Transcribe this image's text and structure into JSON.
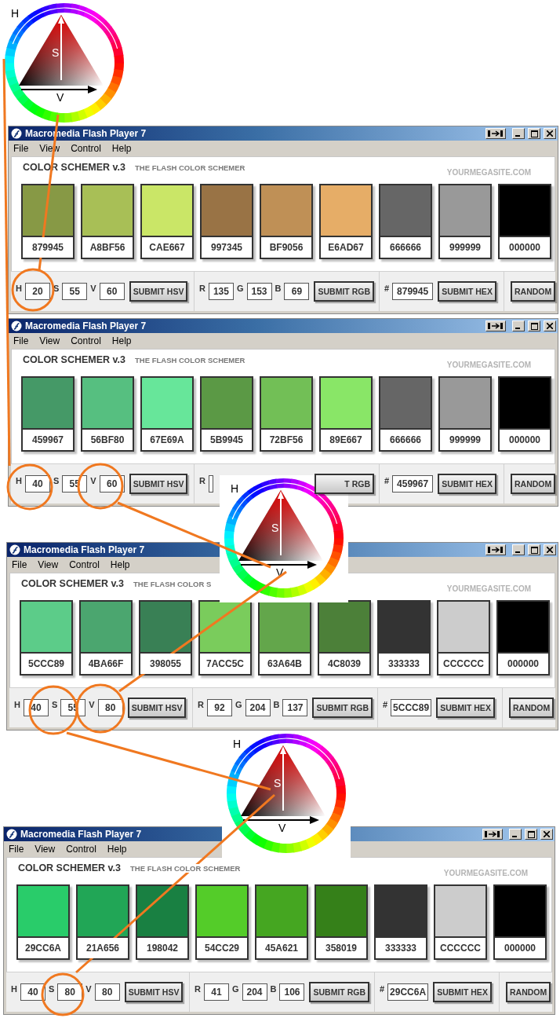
{
  "hsv_diagrams": [
    {
      "h": "H",
      "s": "S",
      "v": "V",
      "framed": false
    },
    {
      "h": "H",
      "s": "S",
      "v": "V",
      "framed": true
    },
    {
      "h": "H",
      "s": "S",
      "v": "V",
      "framed": true
    }
  ],
  "windows": [
    {
      "title": "Macromedia Flash Player 7",
      "menu": [
        "File",
        "View",
        "Control",
        "Help"
      ],
      "app_title": "COLOR SCHEMER v.3",
      "subtitle": "THE FLASH COLOR SCHEMER",
      "site": "YOURMEGASITE.COM",
      "swatches": [
        {
          "hex": "879945",
          "color": "#879945"
        },
        {
          "hex": "A8BF56",
          "color": "#a8bf56"
        },
        {
          "hex": "CAE667",
          "color": "#cae667"
        },
        {
          "hex": "997345",
          "color": "#997345"
        },
        {
          "hex": "BF9056",
          "color": "#bf9056"
        },
        {
          "hex": "E6AD67",
          "color": "#e6ad67"
        },
        {
          "hex": "666666",
          "color": "#666666"
        },
        {
          "hex": "999999",
          "color": "#999999"
        },
        {
          "hex": "000000",
          "color": "#000000"
        }
      ],
      "controls": [
        {
          "fields": [
            {
              "label": "H",
              "value": "20"
            },
            {
              "label": "S",
              "value": "55"
            },
            {
              "label": "V",
              "value": "60"
            }
          ],
          "button": "SUBMIT HSV"
        },
        {
          "fields": [
            {
              "label": "R",
              "value": "135"
            },
            {
              "label": "G",
              "value": "153"
            },
            {
              "label": "B",
              "value": "69"
            }
          ],
          "button": "SUBMIT RGB"
        },
        {
          "fields": [
            {
              "label": "#",
              "value": "879945"
            }
          ],
          "button": "SUBMIT HEX"
        },
        {
          "button": "RANDOM"
        }
      ]
    },
    {
      "title": "Macromedia Flash Player 7",
      "menu": [
        "File",
        "View",
        "Control",
        "Help"
      ],
      "app_title": "COLOR SCHEMER v.3",
      "subtitle": "THE FLASH COLOR SCHEMER",
      "site": "YOURMEGASITE.COM",
      "swatches": [
        {
          "hex": "459967",
          "color": "#459967"
        },
        {
          "hex": "56BF80",
          "color": "#56bf80"
        },
        {
          "hex": "67E69A",
          "color": "#67e69a"
        },
        {
          "hex": "5B9945",
          "color": "#5b9945"
        },
        {
          "hex": "72BF56",
          "color": "#72bf56"
        },
        {
          "hex": "89E667",
          "color": "#89e667"
        },
        {
          "hex": "666666",
          "color": "#666666"
        },
        {
          "hex": "999999",
          "color": "#999999"
        },
        {
          "hex": "000000",
          "color": "#000000"
        }
      ],
      "controls": [
        {
          "fields": [
            {
              "label": "H",
              "value": "40"
            },
            {
              "label": "S",
              "value": "55"
            },
            {
              "label": "V",
              "value": "60"
            }
          ],
          "button": "SUBMIT HSV"
        },
        {
          "fields": [
            {
              "label": "R"
            }
          ],
          "button": "T RGB",
          "cut": true
        },
        {
          "fields": [
            {
              "label": "#",
              "value": "459967"
            }
          ],
          "button": "SUBMIT HEX"
        },
        {
          "button": "RANDOM"
        }
      ]
    },
    {
      "title": "Macromedia Flash Player 7",
      "menu": [
        "File",
        "View",
        "Control",
        "Help"
      ],
      "app_title": "COLOR SCHEMER v.3",
      "subtitle": "THE FLASH COLOR S",
      "site": "YOURMEGASITE.COM",
      "swatches": [
        {
          "hex": "5CCC89",
          "color": "#5ccc89"
        },
        {
          "hex": "4BA66F",
          "color": "#4ba66f"
        },
        {
          "hex": "398055",
          "color": "#398055"
        },
        {
          "hex": "7ACC5C",
          "color": "#7acc5c"
        },
        {
          "hex": "63A64B",
          "color": "#63a64b"
        },
        {
          "hex": "4C8039",
          "color": "#4c8039"
        },
        {
          "hex": "333333",
          "color": "#333333"
        },
        {
          "hex": "CCCCCC",
          "color": "#cccccc"
        },
        {
          "hex": "000000",
          "color": "#000000"
        }
      ],
      "controls": [
        {
          "fields": [
            {
              "label": "H",
              "value": "40"
            },
            {
              "label": "S",
              "value": "55"
            },
            {
              "label": "V",
              "value": "80"
            }
          ],
          "button": "SUBMIT HSV"
        },
        {
          "fields": [
            {
              "label": "R",
              "value": "92"
            },
            {
              "label": "G",
              "value": "204"
            },
            {
              "label": "B",
              "value": "137"
            }
          ],
          "button": "SUBMIT RGB"
        },
        {
          "fields": [
            {
              "label": "#",
              "value": "5CCC89"
            }
          ],
          "button": "SUBMIT HEX"
        },
        {
          "button": "RANDOM"
        }
      ]
    },
    {
      "title": "Macromedia Flash Player 7",
      "menu": [
        "File",
        "View",
        "Control",
        "Help"
      ],
      "app_title": "COLOR SCHEMER v.3",
      "subtitle": "THE FLASH COLOR SCHEMER",
      "site": "YOURMEGASITE.COM",
      "swatches": [
        {
          "hex": "29CC6A",
          "color": "#29cc6a"
        },
        {
          "hex": "21A656",
          "color": "#21a656"
        },
        {
          "hex": "198042",
          "color": "#198042"
        },
        {
          "hex": "54CC29",
          "color": "#54cc29"
        },
        {
          "hex": "45A621",
          "color": "#45a621"
        },
        {
          "hex": "358019",
          "color": "#358019"
        },
        {
          "hex": "333333",
          "color": "#333333"
        },
        {
          "hex": "CCCCCC",
          "color": "#cccccc"
        },
        {
          "hex": "000000",
          "color": "#000000"
        }
      ],
      "controls": [
        {
          "fields": [
            {
              "label": "H",
              "value": "40"
            },
            {
              "label": "S",
              "value": "80"
            },
            {
              "label": "V",
              "value": "80"
            }
          ],
          "button": "SUBMIT HSV"
        },
        {
          "fields": [
            {
              "label": "R",
              "value": "41"
            },
            {
              "label": "G",
              "value": "204"
            },
            {
              "label": "B",
              "value": "106"
            }
          ],
          "button": "SUBMIT RGB"
        },
        {
          "fields": [
            {
              "label": "#",
              "value": "29CC6A"
            }
          ],
          "button": "SUBMIT HEX"
        },
        {
          "button": "RANDOM"
        }
      ]
    }
  ]
}
